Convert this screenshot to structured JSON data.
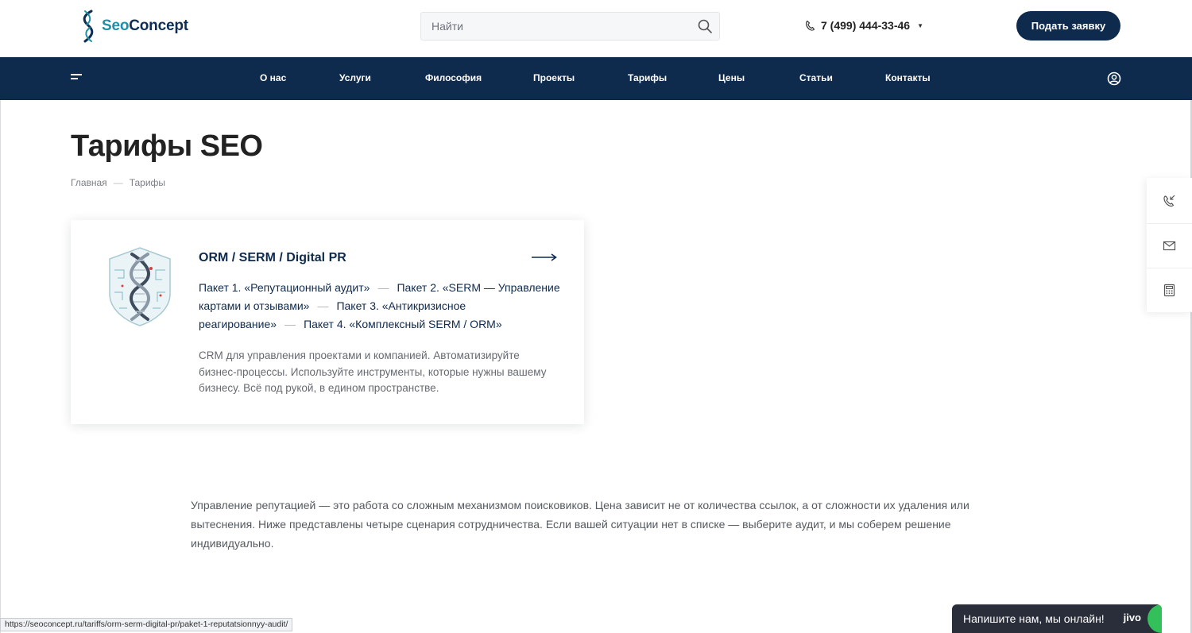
{
  "header": {
    "logo": {
      "part1": "Seo",
      "part2": "Concept"
    },
    "search": {
      "placeholder": "Найти"
    },
    "phone": "7 (499) 444-33-46",
    "cta_label": "Подать заявку"
  },
  "nav": {
    "items": [
      {
        "label": "О нас"
      },
      {
        "label": "Услуги"
      },
      {
        "label": "Философия"
      },
      {
        "label": "Проекты"
      },
      {
        "label": "Тарифы"
      },
      {
        "label": "Цены"
      },
      {
        "label": "Статьи"
      },
      {
        "label": "Контакты"
      }
    ]
  },
  "page": {
    "title": "Тарифы SEO",
    "breadcrumb": {
      "home": "Главная",
      "separator": "—",
      "current": "Тарифы"
    }
  },
  "card": {
    "title": "ORM / SERM / Digital PR",
    "links": [
      "Пакет 1. «Репутационный аудит»",
      "Пакет 2. «SERM — Управление картами и отзывами»",
      "Пакет 3. «Антикризисное реагирование»",
      "Пакет 4. «Комплексный SERM / ORM»"
    ],
    "link_separator": "—",
    "description": "CRM для управления проектами и компанией. Автоматизируйте бизнес-процессы. Используйте инструменты, которые нужны вашему бизнесу. Всё под рукой, в едином пространстве."
  },
  "intro_text": "Управление репутацией — это работа со сложным механизмом поисковиков. Цена зависит не от количества ссылок, а от сложности их удаления или вытеснения. Ниже представлены четыре сценария сотрудничества. Если вашей ситуации нет в списке — выберите аудит, и мы соберем решение индивидуально.",
  "side_panel": {
    "icons": [
      "phone-callback-icon",
      "mail-icon",
      "calculator-icon"
    ]
  },
  "status_url": "https://seoconcept.ru/tariffs/orm-serm-digital-pr/paket-1-reputatsionnyy-audit/",
  "chat": {
    "label": "Напишите нам, мы онлайн!",
    "brand": "jivo"
  },
  "colors": {
    "navy": "#0e2a4d",
    "teal": "#1e8fa6",
    "chat_bg": "#2a2e3b",
    "chat_green": "#33c05a"
  }
}
